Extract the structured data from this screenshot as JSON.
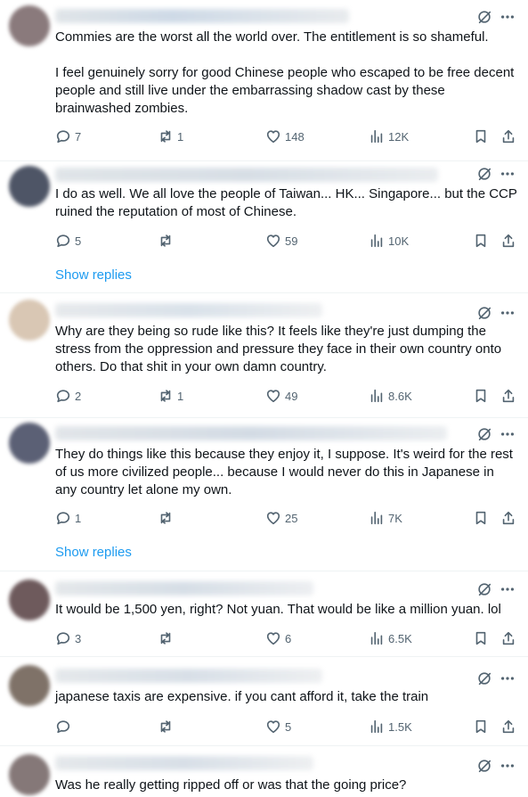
{
  "posts": [
    {
      "paragraphs": [
        "Commies are the worst all the world over.  The entitlement is so shameful.",
        "I feel genuinely sorry for good Chinese people who escaped to be free decent people and still live under the embarrassing shadow cast by these brainwashed zombies."
      ],
      "replies": "7",
      "reposts": "1",
      "likes": "148",
      "views": "12K",
      "avatar_color": "#8a7a7c"
    },
    {
      "paragraphs": [
        "I do as well. We all love the people of Taiwan... HK... Singapore... but the CCP ruined the reputation of most of Chinese."
      ],
      "replies": "5",
      "reposts": "",
      "likes": "59",
      "views": "10K",
      "show_replies": "Show replies",
      "avatar_color": "#4e5566"
    },
    {
      "paragraphs": [
        "Why are they being so rude like this? It feels like they're just dumping the stress from the oppression and pressure they face in their own country onto others. Do that shit in your own damn country."
      ],
      "replies": "2",
      "reposts": "1",
      "likes": "49",
      "views": "8.6K",
      "avatar_color": "#d9c7b4"
    },
    {
      "paragraphs": [
        "They do things like this because they enjoy it, I suppose. It's weird for the rest of us more civilized people... because I would never do this in Japanese in any country let alone my own."
      ],
      "replies": "1",
      "reposts": "",
      "likes": "25",
      "views": "7K",
      "show_replies": "Show replies",
      "avatar_color": "#5b6075"
    },
    {
      "paragraphs": [
        "It would be 1,500 yen, right? Not yuan. That would be like a million yuan. lol"
      ],
      "replies": "3",
      "reposts": "",
      "likes": "6",
      "views": "6.5K",
      "avatar_color": "#6e5a5c"
    },
    {
      "paragraphs": [
        "japanese taxis are expensive. if you cant afford it, take the train"
      ],
      "replies": "",
      "reposts": "",
      "likes": "5",
      "views": "1.5K",
      "avatar_color": "#7f7268"
    },
    {
      "paragraphs": [
        "Was he really getting ripped off or was that the going price?"
      ],
      "avatar_color": "#857878"
    }
  ],
  "colors": {
    "text": "#0f1419",
    "secondary": "#536471",
    "link": "#1d9bf0",
    "divider": "#eff3f4"
  },
  "icons": {
    "reply": "reply-icon",
    "repost": "repost-icon",
    "like": "like-icon",
    "views": "views-icon",
    "bookmark": "bookmark-icon",
    "share": "share-icon",
    "grok": "grok-icon",
    "more": "more-icon"
  }
}
